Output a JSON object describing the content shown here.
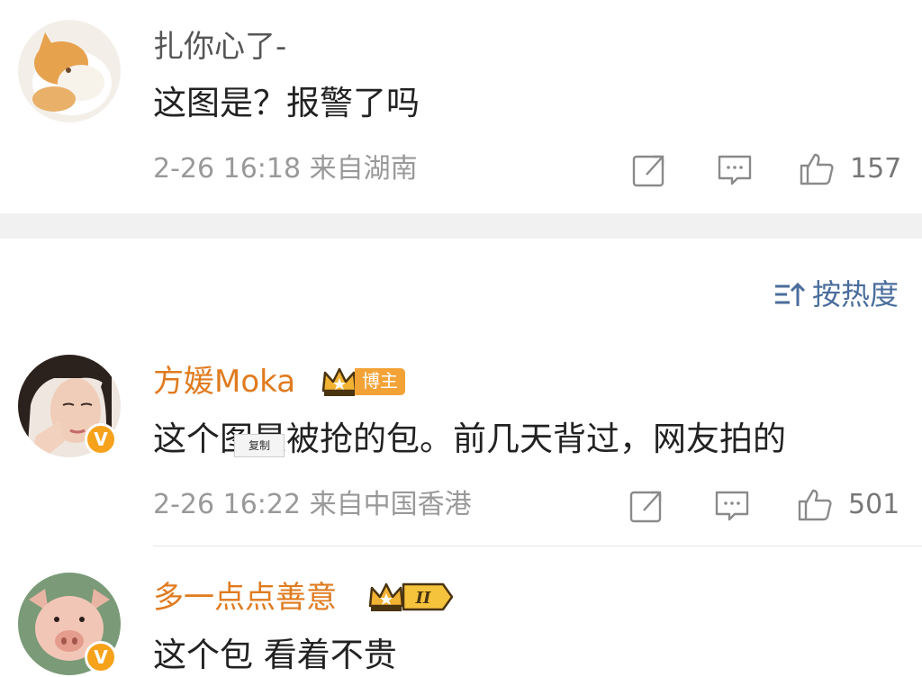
{
  "comments": [
    {
      "username": "扎你心了-",
      "text": "这图是？报警了吗",
      "time": "2-26 16:18",
      "location": "来自湖南",
      "likes": "157",
      "avatar_icon": "cat-avatar"
    },
    {
      "username": "方媛Moka",
      "badge_label": "博主",
      "text": "这个图是被抢的包。前几天背过，网友拍的",
      "time": "2-26 16:22",
      "location": "来自中国香港",
      "likes": "501",
      "avatar_icon": "woman-avatar",
      "verified": "V"
    },
    {
      "username": "多一点点善意",
      "badge_level": "II",
      "text": "这个包 看着不贵",
      "avatar_icon": "pig-avatar",
      "verified": "V"
    }
  ],
  "sort": {
    "label": "按热度",
    "icon": "sort-icon"
  },
  "context_menu": {
    "copy_label": "复制"
  },
  "icons": {
    "share": "share-icon",
    "comment": "comment-icon",
    "like": "thumbs-up-icon",
    "crown": "crown-icon"
  },
  "colors": {
    "gold_name": "#e07b1f",
    "link_blue": "#4a6d9c",
    "badge_orange": "#f3a236",
    "verified_orange": "#f6a21a"
  }
}
